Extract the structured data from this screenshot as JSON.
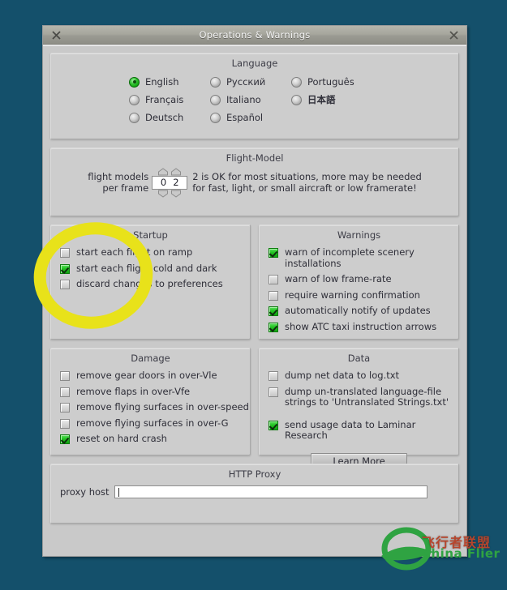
{
  "window": {
    "title": "Operations & Warnings",
    "close_left_icon": "close-icon",
    "close_right_icon": "close-icon"
  },
  "language": {
    "title": "Language",
    "columns": [
      [
        {
          "label": "English",
          "selected": true,
          "bold": false
        },
        {
          "label": "Français",
          "selected": false,
          "bold": false
        },
        {
          "label": "Deutsch",
          "selected": false,
          "bold": false
        }
      ],
      [
        {
          "label": "Русский",
          "selected": false,
          "bold": false
        },
        {
          "label": "Italiano",
          "selected": false,
          "bold": false
        },
        {
          "label": "Español",
          "selected": false,
          "bold": false
        }
      ],
      [
        {
          "label": "Português",
          "selected": false,
          "bold": false
        },
        {
          "label": "日本語",
          "selected": false,
          "bold": true
        }
      ]
    ]
  },
  "flight_model": {
    "title": "Flight-Model",
    "label_line1": "flight models",
    "label_line2": "per frame",
    "value_digit1": "0",
    "value_digit2": "2",
    "value": "02",
    "hint_line1": "2 is OK for most situations, more may be needed",
    "hint_line2": "for fast, light, or small aircraft or low framerate!"
  },
  "startup": {
    "title": "Startup",
    "items": [
      {
        "label": "start each flight on ramp",
        "checked": false
      },
      {
        "label": "start each flight cold and dark",
        "checked": true
      },
      {
        "label": "discard changes to preferences",
        "checked": false
      }
    ]
  },
  "warnings": {
    "title": "Warnings",
    "items": [
      {
        "label": "warn of incomplete scenery installations",
        "checked": true
      },
      {
        "label": "warn of low frame-rate",
        "checked": false
      },
      {
        "label": "require warning confirmation",
        "checked": false
      },
      {
        "label": "automatically notify of updates",
        "checked": true
      },
      {
        "label": "show ATC taxi instruction arrows",
        "checked": true
      }
    ]
  },
  "damage": {
    "title": "Damage",
    "items": [
      {
        "label": "remove gear doors in over-Vle",
        "checked": false
      },
      {
        "label": "remove flaps in over-Vfe",
        "checked": false
      },
      {
        "label": "remove flying surfaces in over-speed",
        "checked": false
      },
      {
        "label": "remove flying surfaces in over-G",
        "checked": false
      },
      {
        "label": "reset on hard crash",
        "checked": true
      }
    ]
  },
  "data_section": {
    "title": "Data",
    "items": [
      {
        "label": "dump net data to log.txt",
        "checked": false
      },
      {
        "label": "dump un-translated language-file\nstrings to 'Untranslated Strings.txt'",
        "checked": false
      },
      {
        "label": "send usage data to Laminar Research",
        "checked": true
      }
    ],
    "learn_more_label": "Learn More"
  },
  "proxy": {
    "title": "HTTP Proxy",
    "label": "proxy host",
    "value": "",
    "placeholder": ""
  },
  "watermark": {
    "chinese": "飞行者联盟",
    "english": "China Flier",
    "icon": "china-flier-logo-icon"
  },
  "annotation": {
    "shape": "yellow-ellipse-highlight",
    "color": "#e8e21a"
  },
  "colors": {
    "desktop_bg": "#14506b",
    "panel": "#cdcdcd",
    "accent_green": "#22c322",
    "title_text": "#f2f2f2"
  }
}
